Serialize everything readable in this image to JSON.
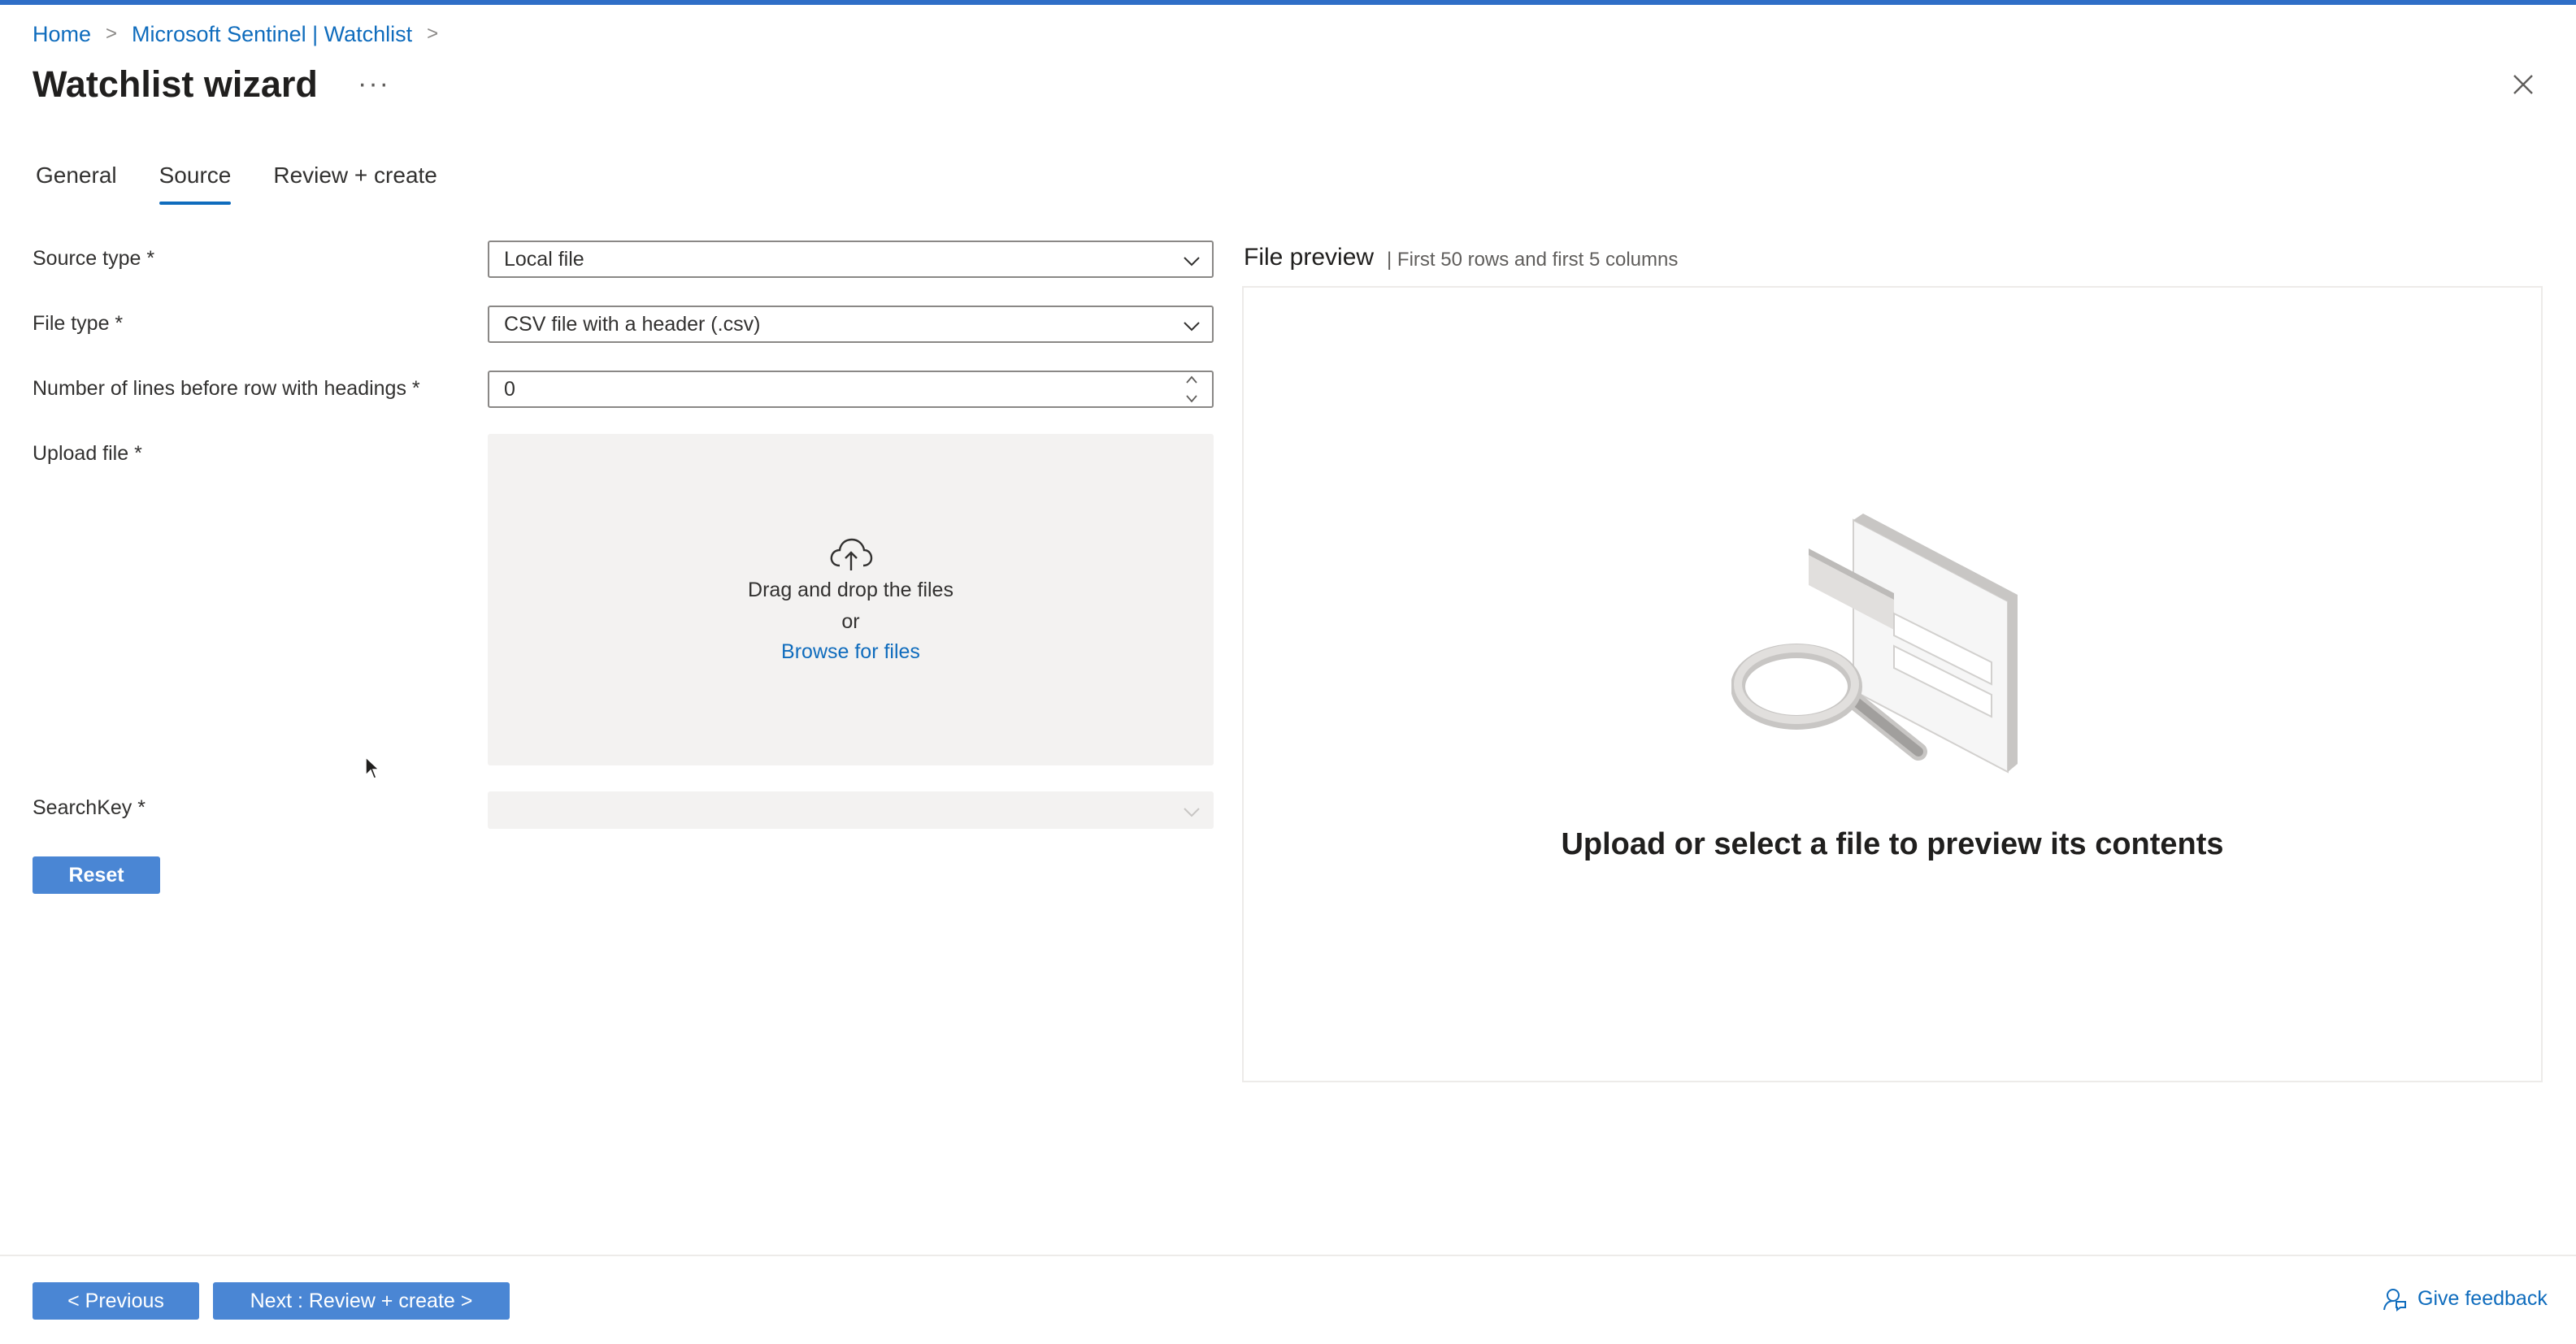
{
  "breadcrumb": {
    "home": "Home",
    "sentinel": "Microsoft Sentinel | Watchlist",
    "sep": ">"
  },
  "title": "Watchlist wizard",
  "more_label": "···",
  "tabs": [
    {
      "label": "General",
      "active": false
    },
    {
      "label": "Source",
      "active": true
    },
    {
      "label": "Review + create",
      "active": false
    }
  ],
  "form": {
    "source_type": {
      "label": "Source type *",
      "value": "Local file"
    },
    "file_type": {
      "label": "File type *",
      "value": "CSV file with a header (.csv)"
    },
    "lines_before": {
      "label": "Number of lines before row with headings *",
      "value": "0"
    },
    "upload": {
      "label": "Upload file *",
      "drag_text": "Drag and drop the files",
      "or_text": "or",
      "browse_text": "Browse for files"
    },
    "search_key": {
      "label": "SearchKey *",
      "value": ""
    }
  },
  "reset_label": "Reset",
  "preview": {
    "title": "File preview",
    "subtitle": "| First 50 rows and first 5 columns",
    "message": "Upload or select a file to preview its contents"
  },
  "footer": {
    "previous_label": "< Previous",
    "next_label": "Next : Review + create >",
    "feedback_label": "Give feedback"
  },
  "colors": {
    "accent": "#0f6cbd",
    "primary_button": "#4a86d4",
    "top_bar": "#2f6ec7"
  },
  "icons": [
    "chevron-right-icon",
    "close-icon",
    "chevron-down-icon",
    "cloud-upload-icon",
    "feedback-icon",
    "magnifier-illustration"
  ]
}
